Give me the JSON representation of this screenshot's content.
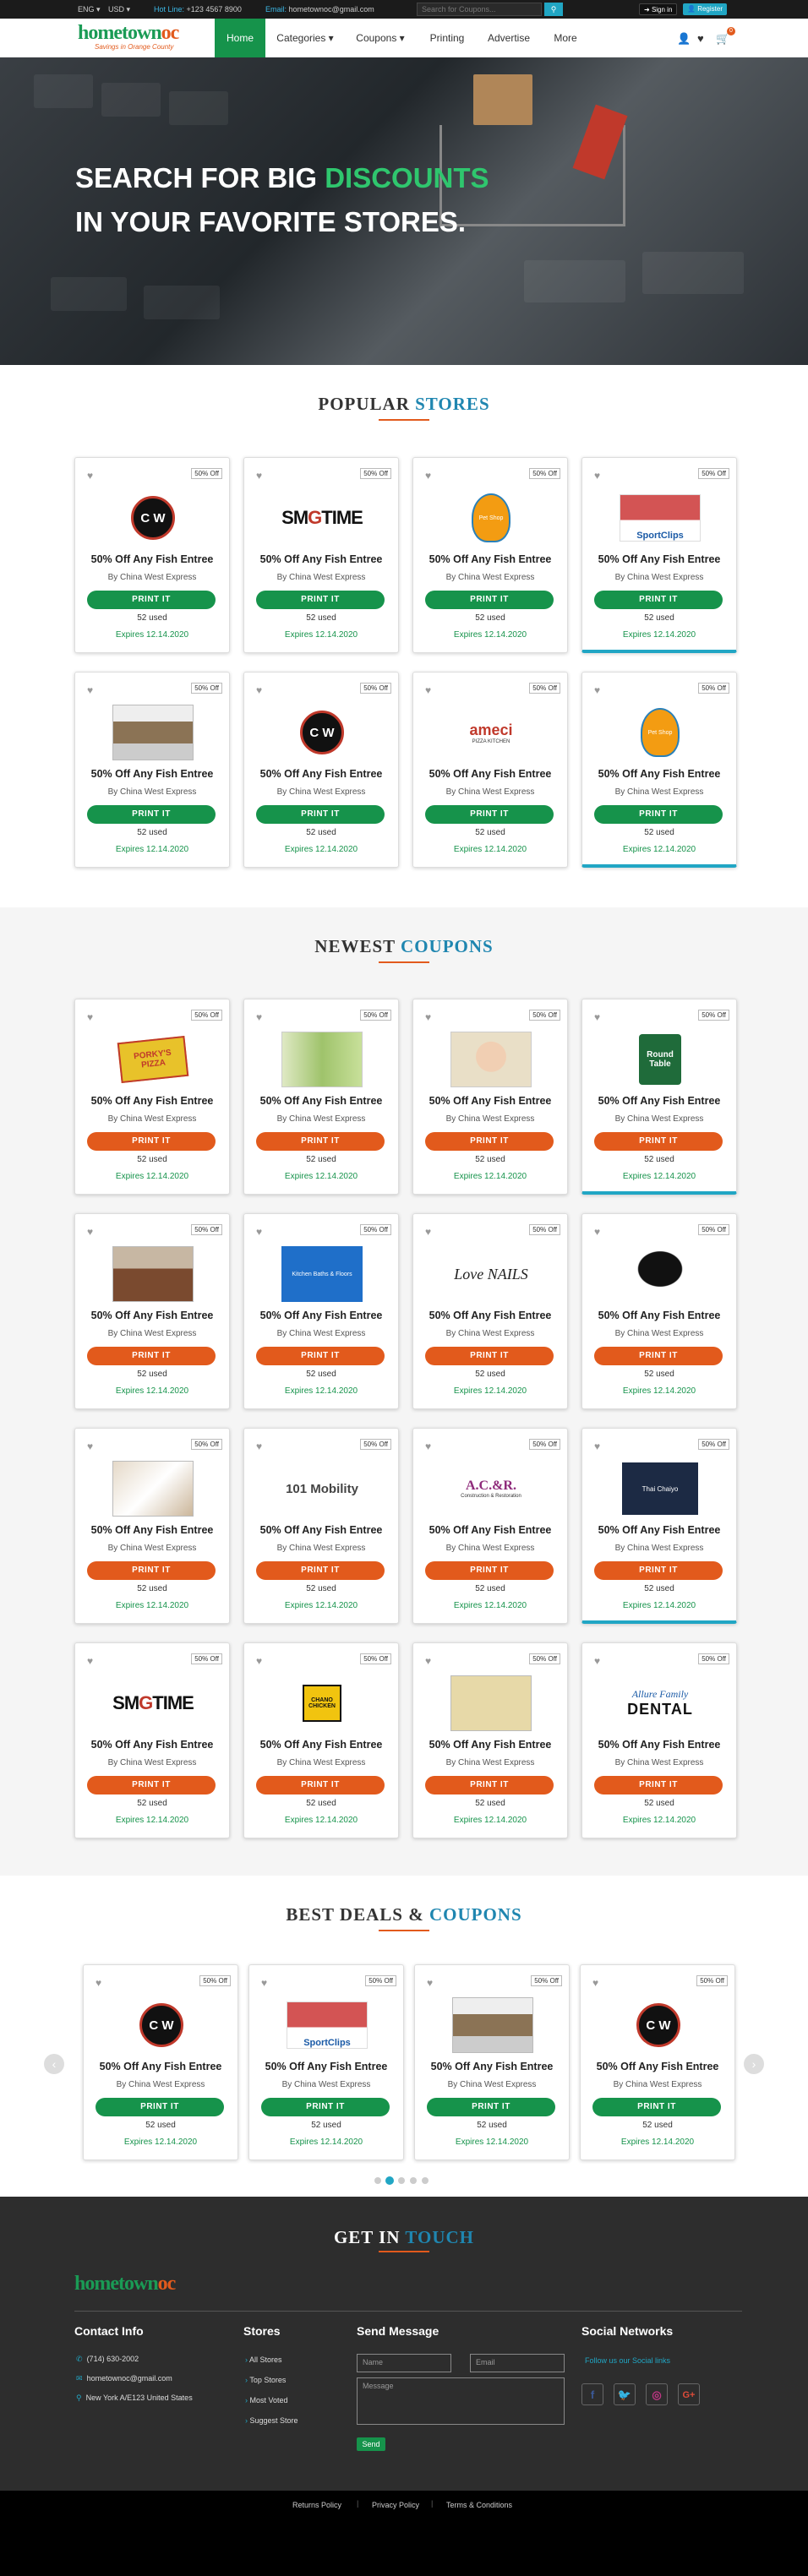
{
  "topbar": {
    "lang": "ENG",
    "currency": "USD",
    "hotline_label": "Hot Line:",
    "hotline": "+123 4567 8900",
    "email_label": "Email:",
    "email": "hometownoc@gmail.com",
    "search_placeholder": "Search for Coupons...",
    "signin": "Sign in",
    "register": "Register"
  },
  "nav": {
    "logo": "hometown",
    "logo_oc": "oc",
    "logo_tag": "Savings in Orange County",
    "items": [
      "Home",
      "Categories",
      "Coupons",
      "Printing",
      "Advertise",
      "More"
    ],
    "cart_count": "0"
  },
  "hero": {
    "line1_a": "SEARCH FOR BIG ",
    "line1_b": "DISCOUNTS",
    "line2": "IN YOUR FAVORITE STORES."
  },
  "popular": {
    "title_a": "POPULAR ",
    "title_b": "STORES"
  },
  "newest": {
    "title_a": "NEWEST ",
    "title_b": "COUPONS"
  },
  "best": {
    "title_a": "BEST DEALS & ",
    "title_b": "COUPONS"
  },
  "card": {
    "off": "50% Off",
    "title": "50% Off Any Fish Entree",
    "by": "By China West Express",
    "print": "PRINT IT",
    "used": "52 used",
    "expires": "Expires 12.14.2020"
  },
  "logos": {
    "cw": "C W",
    "smog_a": "SM",
    "smog_b": "G",
    "smog_c": "TIME",
    "pork": "PORKY'S PIZZA",
    "round": "Round Table",
    "love": "Love NAILS",
    "mobility": "101 Mobility",
    "acr": "A.C.&R.",
    "acr_sub": "Construction & Restoration",
    "thai": "Thai Chaiyo",
    "chano": "CHANO CHICKEN",
    "allure": "Allure Family",
    "dental": "DENTAL",
    "ameci": "ameci",
    "ameci_sub": "PIZZA KITCHEN",
    "sport": "SportClips",
    "kitchen": "Kitchen Baths & Floors",
    "pet": "Pet Shop"
  },
  "footer": {
    "title_a": "GET IN ",
    "title_b": "TOUCH",
    "contact_title": "Contact Info",
    "phone": "(714) 630-2002",
    "email": "hometownoc@gmail.com",
    "address": "New York A/E123 United States",
    "stores_title": "Stores",
    "stores": [
      "All Stores",
      "Top Stores",
      "Most Voted",
      "Suggest Store"
    ],
    "send_title": "Send Message",
    "name_ph": "Name",
    "email_ph": "Email",
    "msg_ph": "Message",
    "send": "Send",
    "social_title": "Social Networks",
    "follow": "Follow us our Social links"
  },
  "bottom": {
    "links": [
      "Returns Policy",
      "Privacy Policy",
      "Terms & Conditions"
    ]
  }
}
